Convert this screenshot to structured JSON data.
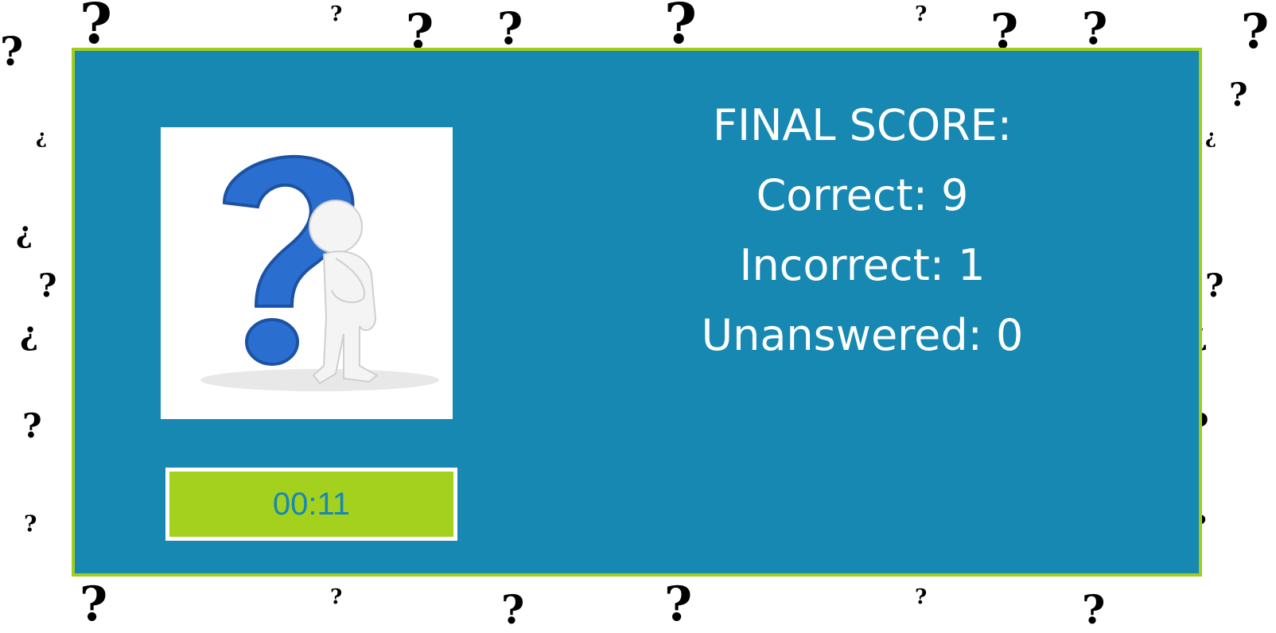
{
  "score": {
    "title": "FINAL SCORE:",
    "correct": "Correct: 9",
    "incorrect": "Incorrect: 1",
    "unanswered": "Unanswered: 0"
  },
  "timer": {
    "value": "00:11"
  },
  "icons": {
    "thinking_figure": "question-mark-thinking-figure-icon",
    "background": "question-mark-pattern"
  },
  "colors": {
    "panel_bg": "#1788b2",
    "panel_border": "#a0cd1e",
    "timer_bg": "#a3d11e",
    "timer_text": "#1788b2",
    "text": "#ffffff",
    "question_mark": "#2a6fd0"
  }
}
